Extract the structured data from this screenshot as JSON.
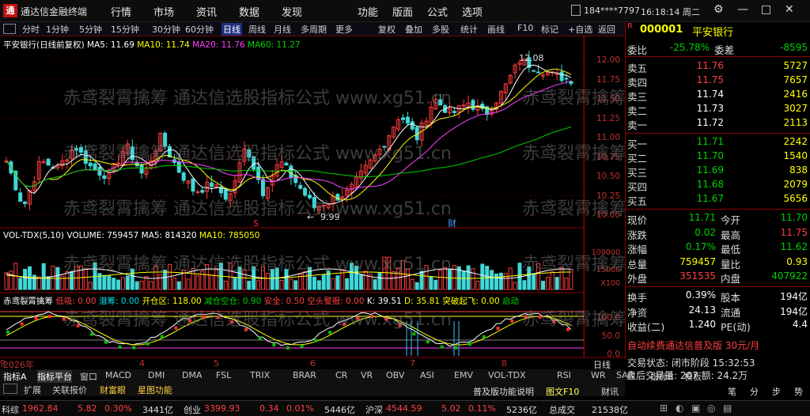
{
  "window": {
    "title": "通达信金融终端",
    "logo": "通"
  },
  "menu": [
    "行情",
    "市场",
    "资讯",
    "数据",
    "发现",
    "功能",
    "版面",
    "公式",
    "选项"
  ],
  "user": "184****7797",
  "clock": "16:18:14 周二",
  "toolbar": [
    "分时",
    "1分钟",
    "5分钟",
    "15分钟",
    "30分钟",
    "60分钟",
    "日线",
    "周线",
    "月线",
    "多周期",
    "更多",
    "复权",
    "叠加",
    "多股",
    "统计",
    "画线",
    "F10",
    "标记",
    "+自选",
    "返回"
  ],
  "chart": {
    "name": "平安银行(日线前复权)",
    "ma5": "MA5: 11.69",
    "ma10": "MA10: 11.74",
    "ma20": "MA20: 11.76",
    "ma60": "MA60: 11.27",
    "high_mark": "12.08",
    "low_mark": "9.99",
    "price_ticks": [
      "12.00",
      "11.75",
      "11.50",
      "11.25",
      "11.00",
      "10.75",
      "10.50",
      "10.25",
      "10.00"
    ],
    "events": [
      "S",
      "财"
    ],
    "colors": {
      "up": "#ff3c3c",
      "down": "#40d8d8",
      "ma5": "#ffffff",
      "ma10": "#ffff00",
      "ma20": "#ff40ff",
      "ma60": "#00d000"
    }
  },
  "volume": {
    "label": "VOL-TDX(5,10)",
    "value": "VOLUME: 759457",
    "ma5": "MA5: 814320",
    "ma10": "MA10: 785050",
    "ticks": [
      "100000",
      "15000",
      "X100"
    ]
  },
  "indicator": {
    "name": "赤鸢裂霄擒筹",
    "low": "低吸: 0.00",
    "up": "潜筹: 0.00",
    "open": "开仓区: 118.00",
    "reduce": "减仓空仓: 0.90",
    "safe": "安全: 0.50",
    "warn": "空头警报: 0.00",
    "k": "K: 39.51",
    "d": "D: 35.81",
    "rise": "突破起飞: 0.00",
    "start": "启动",
    "ticks": [
      "100.0",
      "50.0",
      "0.0"
    ]
  },
  "dates": [
    "2026年",
    "4",
    "5",
    "6",
    "7",
    "8",
    "9"
  ],
  "dayline": "日线",
  "tabs1": [
    "指标A",
    "指标平台",
    "窗口",
    "MACD",
    "DMI",
    "DMA",
    "FSL",
    "TRIX",
    "BRAR",
    "CR",
    "VR",
    "OBV",
    "ASI",
    "EMV",
    "VOL-TDX",
    "RSI",
    "WR",
    "SAR",
    "指标B",
    "模板"
  ],
  "tabs2": [
    "扩展",
    "关联报价",
    "财富眼",
    "星图功能"
  ],
  "quote": {
    "code": "000001",
    "name": "平安银行",
    "weibi_label": "委比",
    "weibi": "-25.78%",
    "weicha_label": "委差",
    "weicha": "-8595",
    "asks": [
      {
        "l": "卖五",
        "p": "11.76",
        "v": "5727"
      },
      {
        "l": "卖四",
        "p": "11.75",
        "v": "7657"
      },
      {
        "l": "卖三",
        "p": "11.74",
        "v": "2416"
      },
      {
        "l": "卖二",
        "p": "11.73",
        "v": "3027"
      },
      {
        "l": "卖一",
        "p": "11.72",
        "v": "2113"
      }
    ],
    "bids": [
      {
        "l": "买一",
        "p": "11.71",
        "v": "2242"
      },
      {
        "l": "买二",
        "p": "11.70",
        "v": "1540"
      },
      {
        "l": "买三",
        "p": "11.69",
        "v": "838"
      },
      {
        "l": "买四",
        "p": "11.68",
        "v": "2079"
      },
      {
        "l": "买五",
        "p": "11.67",
        "v": "5656"
      }
    ],
    "stats": [
      {
        "l": "现价",
        "v": "11.71",
        "l2": "今开",
        "v2": "11.70"
      },
      {
        "l": "涨跌",
        "v": "0.02",
        "l2": "最高",
        "v2": "11.75"
      },
      {
        "l": "涨幅",
        "v": "0.17%",
        "l2": "最低",
        "v2": "11.62"
      },
      {
        "l": "总量",
        "v": "759457",
        "l2": "量比",
        "v2": "0.93"
      },
      {
        "l": "外盘",
        "v": "351535",
        "l2": "内盘",
        "v2": "407922"
      }
    ],
    "stats2": [
      {
        "l": "换手",
        "v": "0.39%",
        "l2": "股本",
        "v2": "194亿"
      },
      {
        "l": "净资",
        "v": "24.13",
        "l2": "流通",
        "v2": "194亿"
      },
      {
        "l": "收益(二)",
        "v": "1.240",
        "l2": "PE(动)",
        "v2": "4.4"
      }
    ],
    "banner": "自动续费通达信普及版 30元/月",
    "trade_status": "交易状态: 闭市阶段 15:32:53",
    "panel_vol": "盘后交易量: 207  额: 24.2万",
    "bottom_btns": [
      "普及版功能说明",
      "图文F10",
      "财讯",
      "笔",
      "分",
      "步",
      "势"
    ]
  },
  "status": [
    {
      "n": "科综",
      "v": "1962.84",
      "c": "5.82",
      "p": "0.30%",
      "a": "3441亿"
    },
    {
      "n": "创业",
      "v": "3399.93",
      "c": "0.34",
      "p": "0.01%",
      "a": "5446亿"
    },
    {
      "n": "沪深",
      "v": "4544.59",
      "c": "5.02",
      "p": "0.11%",
      "a": "5236亿"
    }
  ],
  "status_total_label": "总成交",
  "status_total": "21538亿",
  "watermark": "赤鸢裂霄擒筹 通达信选股指标公式 www.xg51.cn"
}
